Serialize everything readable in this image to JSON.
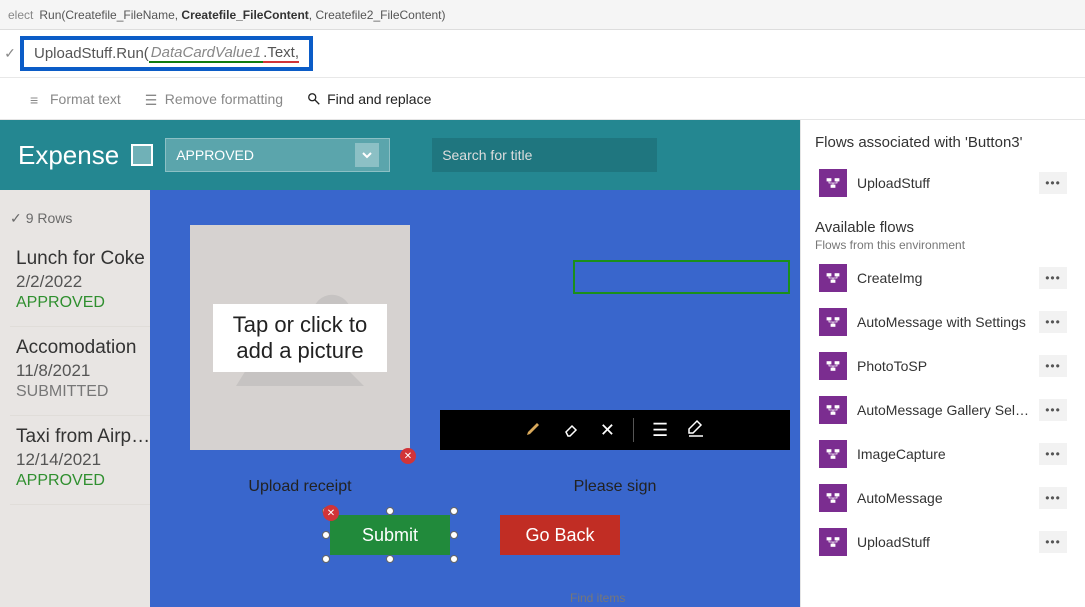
{
  "topbar": {
    "prefix": "elect",
    "signature_pre": "Run(Createfile_FileName, ",
    "signature_bold": "Createfile_FileContent",
    "signature_post": ", Createfile2_FileContent)"
  },
  "formula": {
    "prefix": "UploadStuff.Run(",
    "italic": "DataCardValue1",
    "prop": ".Text",
    "after": ","
  },
  "toolbar": {
    "format": "Format text",
    "remove": "Remove formatting",
    "find": "Find and replace"
  },
  "header": {
    "title": "Expense",
    "dropdown": "APPROVED",
    "search_placeholder": "Search for title"
  },
  "rows_label": "9 Rows",
  "list": [
    {
      "title": "Lunch for Coke",
      "date": "2/2/2022",
      "status": "APPROVED",
      "status_class": "approved"
    },
    {
      "title": "Accomodation",
      "date": "11/8/2021",
      "status": "SUBMITTED",
      "status_class": "submitted"
    },
    {
      "title": "Taxi from Airp…",
      "date": "12/14/2021",
      "status": "APPROVED",
      "status_class": "approved"
    }
  ],
  "modal": {
    "tap_label1": "Tap or click to",
    "tap_label2": "add a picture",
    "upload_caption": "Upload receipt",
    "sign_caption": "Please sign",
    "submit": "Submit",
    "goback": "Go Back",
    "find_items": "Find items"
  },
  "panel": {
    "title": "Flows associated with 'Button3'",
    "associated": [
      {
        "name": "UploadStuff"
      }
    ],
    "available_header": "Available flows",
    "available_sub": "Flows from this environment",
    "available": [
      {
        "name": "CreateImg"
      },
      {
        "name": "AutoMessage with Settings"
      },
      {
        "name": "PhotoToSP"
      },
      {
        "name": "AutoMessage Gallery Select…"
      },
      {
        "name": "ImageCapture"
      },
      {
        "name": "AutoMessage"
      },
      {
        "name": "UploadStuff"
      }
    ]
  }
}
